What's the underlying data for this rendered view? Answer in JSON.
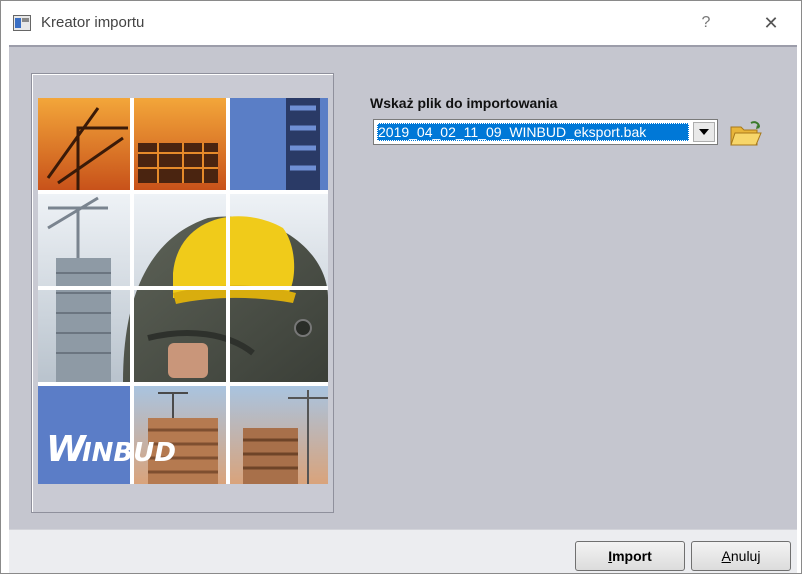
{
  "window": {
    "title": "Kreator importu",
    "help_label": "?",
    "close_label": "✕"
  },
  "image": {
    "logo_text": "WINBUD",
    "icon": "winbud-splash-image"
  },
  "file": {
    "label": "Wskaż plik do importowania",
    "value": "2019_04_02_11_09_WINBUD_eksport.bak",
    "browse_icon": "folder-open-icon"
  },
  "buttons": {
    "import_first": "I",
    "import_rest": "mport",
    "cancel_first": "A",
    "cancel_rest": "nuluj"
  },
  "colors": {
    "client_bg": "#c5c6cf",
    "selection": "#0078d7",
    "logo_blue": "#5b7dc7"
  }
}
